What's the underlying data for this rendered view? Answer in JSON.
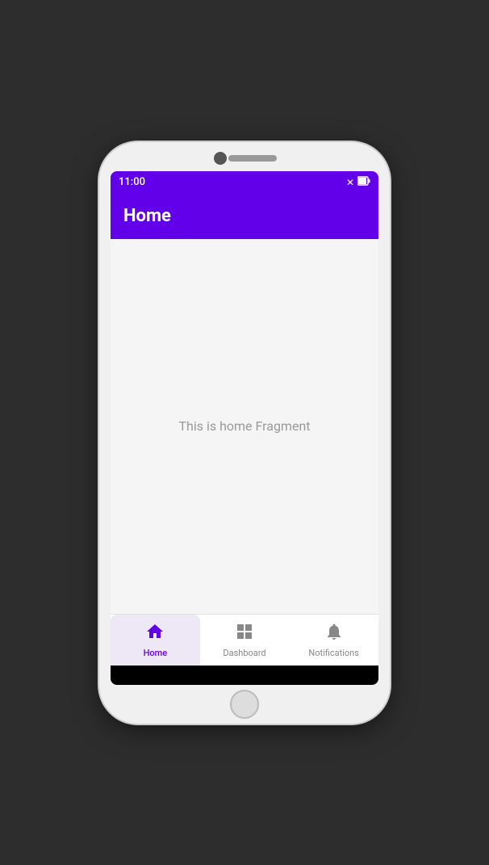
{
  "status_bar": {
    "time": "11:00",
    "close_icon": "✕",
    "battery_icon": "🔋"
  },
  "app_bar": {
    "title": "Home"
  },
  "content": {
    "text": "This is home Fragment"
  },
  "bottom_nav": {
    "items": [
      {
        "id": "home",
        "label": "Home",
        "active": true
      },
      {
        "id": "dashboard",
        "label": "Dashboard",
        "active": false
      },
      {
        "id": "notifications",
        "label": "Notifications",
        "active": false
      }
    ]
  },
  "colors": {
    "primary": "#6200ea",
    "active_bg": "#ede7f6",
    "active_fg": "#6200ea",
    "inactive_fg": "#888888"
  }
}
